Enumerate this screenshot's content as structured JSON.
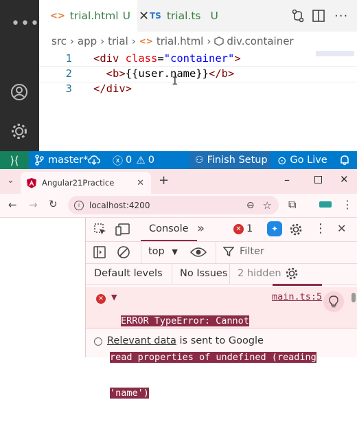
{
  "editor": {
    "tabs": [
      {
        "icon": "<>",
        "name": "trial.html",
        "status": "U"
      },
      {
        "icon": "TS",
        "name": "trial.ts",
        "status": "U"
      }
    ],
    "breadcrumb": [
      "src",
      "app",
      "trial",
      "trial.html",
      "div.container"
    ],
    "lines": [
      {
        "number": "1",
        "tokens": [
          [
            "tg",
            "<div "
          ],
          [
            "at",
            "class"
          ],
          [
            "tx",
            "="
          ],
          [
            "st",
            "\"container\""
          ],
          [
            "tg",
            ">"
          ]
        ]
      },
      {
        "number": "2",
        "tokens": [
          [
            "tg",
            "  <b>"
          ],
          [
            "tx",
            "{{user.name}}"
          ],
          [
            "tg",
            "</b>"
          ]
        ]
      },
      {
        "number": "3",
        "tokens": [
          [
            "tg",
            "</div>"
          ]
        ]
      }
    ]
  },
  "statusbar": {
    "branch": "master*",
    "errors": "0",
    "warnings": "0",
    "finish_setup": "Finish Setup",
    "go_live": "Go Live"
  },
  "browser": {
    "tab_title": "Angular21Practice",
    "url": "localhost:4200"
  },
  "devtools": {
    "panel": "Console",
    "error_count": "1",
    "context": "top",
    "filter_placeholder": "Filter",
    "levels": "Default levels",
    "issues": "No Issues",
    "hidden": "2 hidden",
    "error_lines": [
      "ERROR TypeError: Cannot",
      "read properties of undefined (reading",
      "'name')"
    ],
    "error_source": "main.ts:5",
    "relevant_link": "Relevant data",
    "relevant_rest": "is sent to Google"
  },
  "colors": {
    "activity_bar": "#2c2c2c",
    "status_bar": "#007acc",
    "error_red": "#d32f2f",
    "error_highlight": "#8b2c47",
    "browser_tint": "#fbe4e8"
  }
}
